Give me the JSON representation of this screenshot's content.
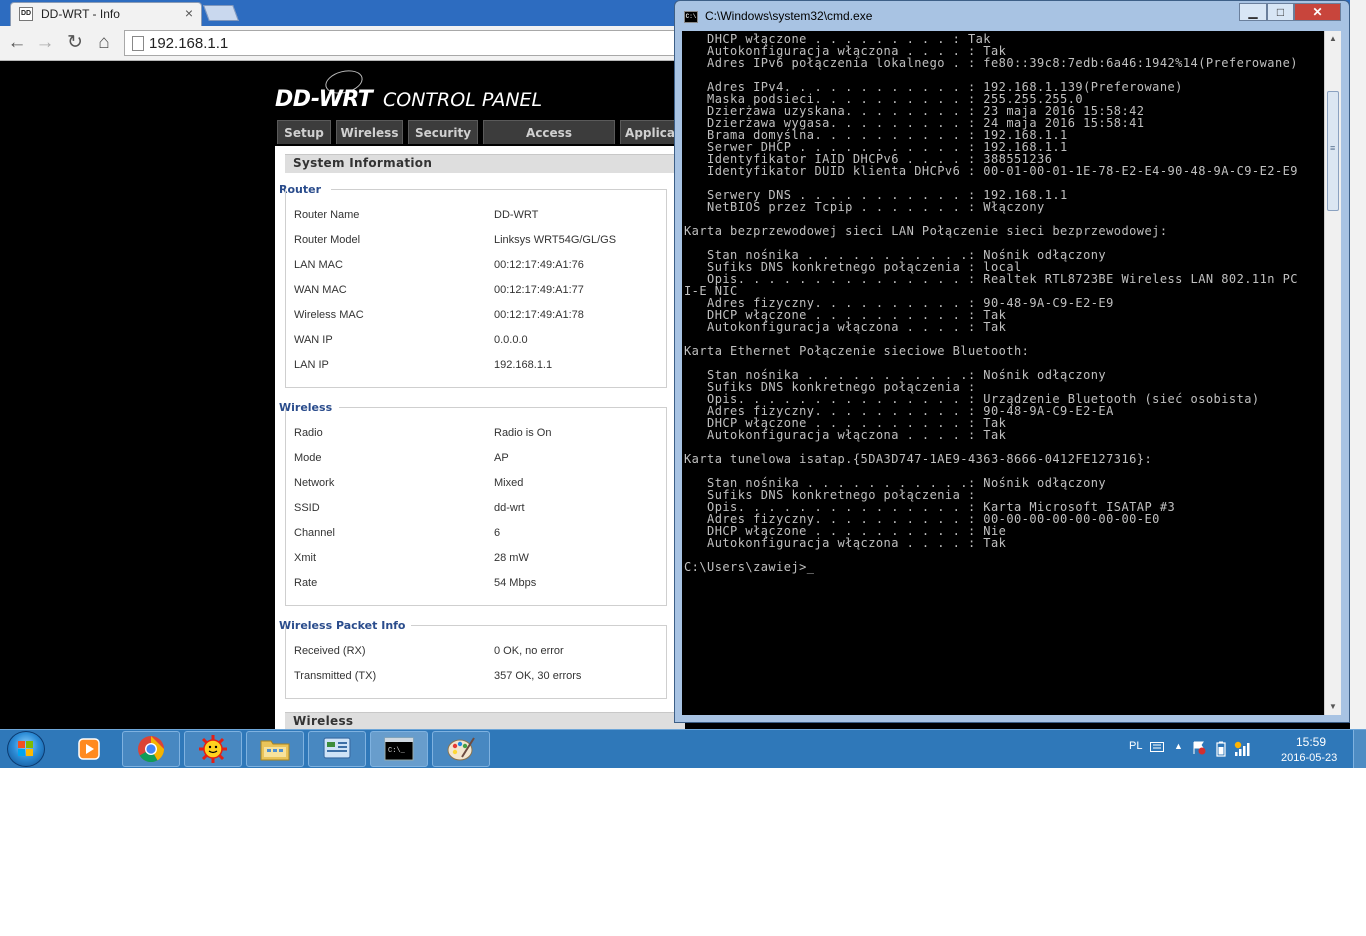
{
  "browser": {
    "tab_title": "DD-WRT - Info",
    "tab_close": "×",
    "url": "192.168.1.1",
    "nav": {
      "back": "←",
      "forward": "→",
      "reload": "↻",
      "home": "⌂"
    }
  },
  "ddwrt": {
    "logo_main": "DD-WRT",
    "logo_sub": "CONTROL PANEL",
    "menu": [
      "Setup",
      "Wireless",
      "Security",
      "Access Restrictions",
      "Applica"
    ],
    "system_info_title": "System Information",
    "router": {
      "title": "Router",
      "rows": [
        {
          "label": "Router Name",
          "value": "DD-WRT"
        },
        {
          "label": "Router Model",
          "value": "Linksys WRT54G/GL/GS"
        },
        {
          "label": "LAN MAC",
          "value": "00:12:17:49:A1:76"
        },
        {
          "label": "WAN MAC",
          "value": "00:12:17:49:A1:77"
        },
        {
          "label": "Wireless MAC",
          "value": "00:12:17:49:A1:78"
        },
        {
          "label": "WAN IP",
          "value": "0.0.0.0"
        },
        {
          "label": "LAN IP",
          "value": "192.168.1.1"
        }
      ]
    },
    "wireless": {
      "title": "Wireless",
      "rows": [
        {
          "label": "Radio",
          "value": "Radio is On"
        },
        {
          "label": "Mode",
          "value": "AP"
        },
        {
          "label": "Network",
          "value": "Mixed"
        },
        {
          "label": "SSID",
          "value": "dd-wrt"
        },
        {
          "label": "Channel",
          "value": "6"
        },
        {
          "label": "Xmit",
          "value": "28 mW"
        },
        {
          "label": "Rate",
          "value": "54 Mbps"
        }
      ]
    },
    "packet_info": {
      "title": "Wireless Packet Info",
      "rows": [
        {
          "label": "Received (RX)",
          "value": "0 OK, no error"
        },
        {
          "label": "Transmitted (TX)",
          "value": "357 OK, 30 errors"
        }
      ]
    },
    "bottom_section_title": "Wireless"
  },
  "cmd": {
    "title": "C:\\Windows\\system32\\cmd.exe",
    "buttons": {
      "minimize": "▁",
      "maximize": "□",
      "close": "✕"
    },
    "lines": [
      "   DHCP włączone . . . . . . . . . : Tak",
      "   Autokonfiguracja włączona . . . . : Tak",
      "   Adres IPv6 połączenia lokalnego . : fe80::39c8:7edb:6a46:1942%14(Preferowane)",
      "",
      "   Adres IPv4. . . . . . . . . . . . : 192.168.1.139(Preferowane)",
      "   Maska podsieci. . . . . . . . . . : 255.255.255.0",
      "   Dzierżawa uzyskana. . . . . . . . : 23 maja 2016 15:58:42",
      "   Dzierżawa wygasa. . . . . . . . . : 24 maja 2016 15:58:41",
      "   Brama domyślna. . . . . . . . . . : 192.168.1.1",
      "   Serwer DHCP . . . . . . . . . . . : 192.168.1.1",
      "   Identyfikator IAID DHCPv6 . . . . : 388551236",
      "   Identyfikator DUID klienta DHCPv6 : 00-01-00-01-1E-78-E2-E4-90-48-9A-C9-E2-E9",
      "",
      "   Serwery DNS . . . . . . . . . . . : 192.168.1.1",
      "   NetBIOS przez Tcpip . . . . . . . : Włączony",
      "",
      "Karta bezprzewodowej sieci LAN Połączenie sieci bezprzewodowej:",
      "",
      "   Stan nośnika . . . . . . . . . . .: Nośnik odłączony",
      "   Sufiks DNS konkretnego połączenia : local",
      "   Opis. . . . . . . . . . . . . . . : Realtek RTL8723BE Wireless LAN 802.11n PC",
      "I-E NIC",
      "   Adres fizyczny. . . . . . . . . . : 90-48-9A-C9-E2-E9",
      "   DHCP włączone . . . . . . . . . . : Tak",
      "   Autokonfiguracja włączona . . . . : Tak",
      "",
      "Karta Ethernet Połączenie sieciowe Bluetooth:",
      "",
      "   Stan nośnika . . . . . . . . . . .: Nośnik odłączony",
      "   Sufiks DNS konkretnego połączenia :",
      "   Opis. . . . . . . . . . . . . . . : Urządzenie Bluetooth (sieć osobista)",
      "   Adres fizyczny. . . . . . . . . . : 90-48-9A-C9-E2-EA",
      "   DHCP włączone . . . . . . . . . . : Tak",
      "   Autokonfiguracja włączona . . . . : Tak",
      "",
      "Karta tunelowa isatap.{5DA3D747-1AE9-4363-8666-0412FE127316}:",
      "",
      "   Stan nośnika . . . . . . . . . . .: Nośnik odłączony",
      "   Sufiks DNS konkretnego połączenia :",
      "   Opis. . . . . . . . . . . . . . . : Karta Microsoft ISATAP #3",
      "   Adres fizyczny. . . . . . . . . . : 00-00-00-00-00-00-00-E0",
      "   DHCP włączone . . . . . . . . . . : Nie",
      "   Autokonfiguracja włączona . . . . : Tak",
      "",
      "C:\\Users\\zawiej>_"
    ]
  },
  "taskbar": {
    "pinned": [
      "windows-media-player",
      "chrome",
      "weather-sun",
      "file-explorer",
      "control-panel",
      "cmd-prompt",
      "paint"
    ],
    "language": "PL",
    "time": "15:59",
    "date": "2016-05-23"
  }
}
